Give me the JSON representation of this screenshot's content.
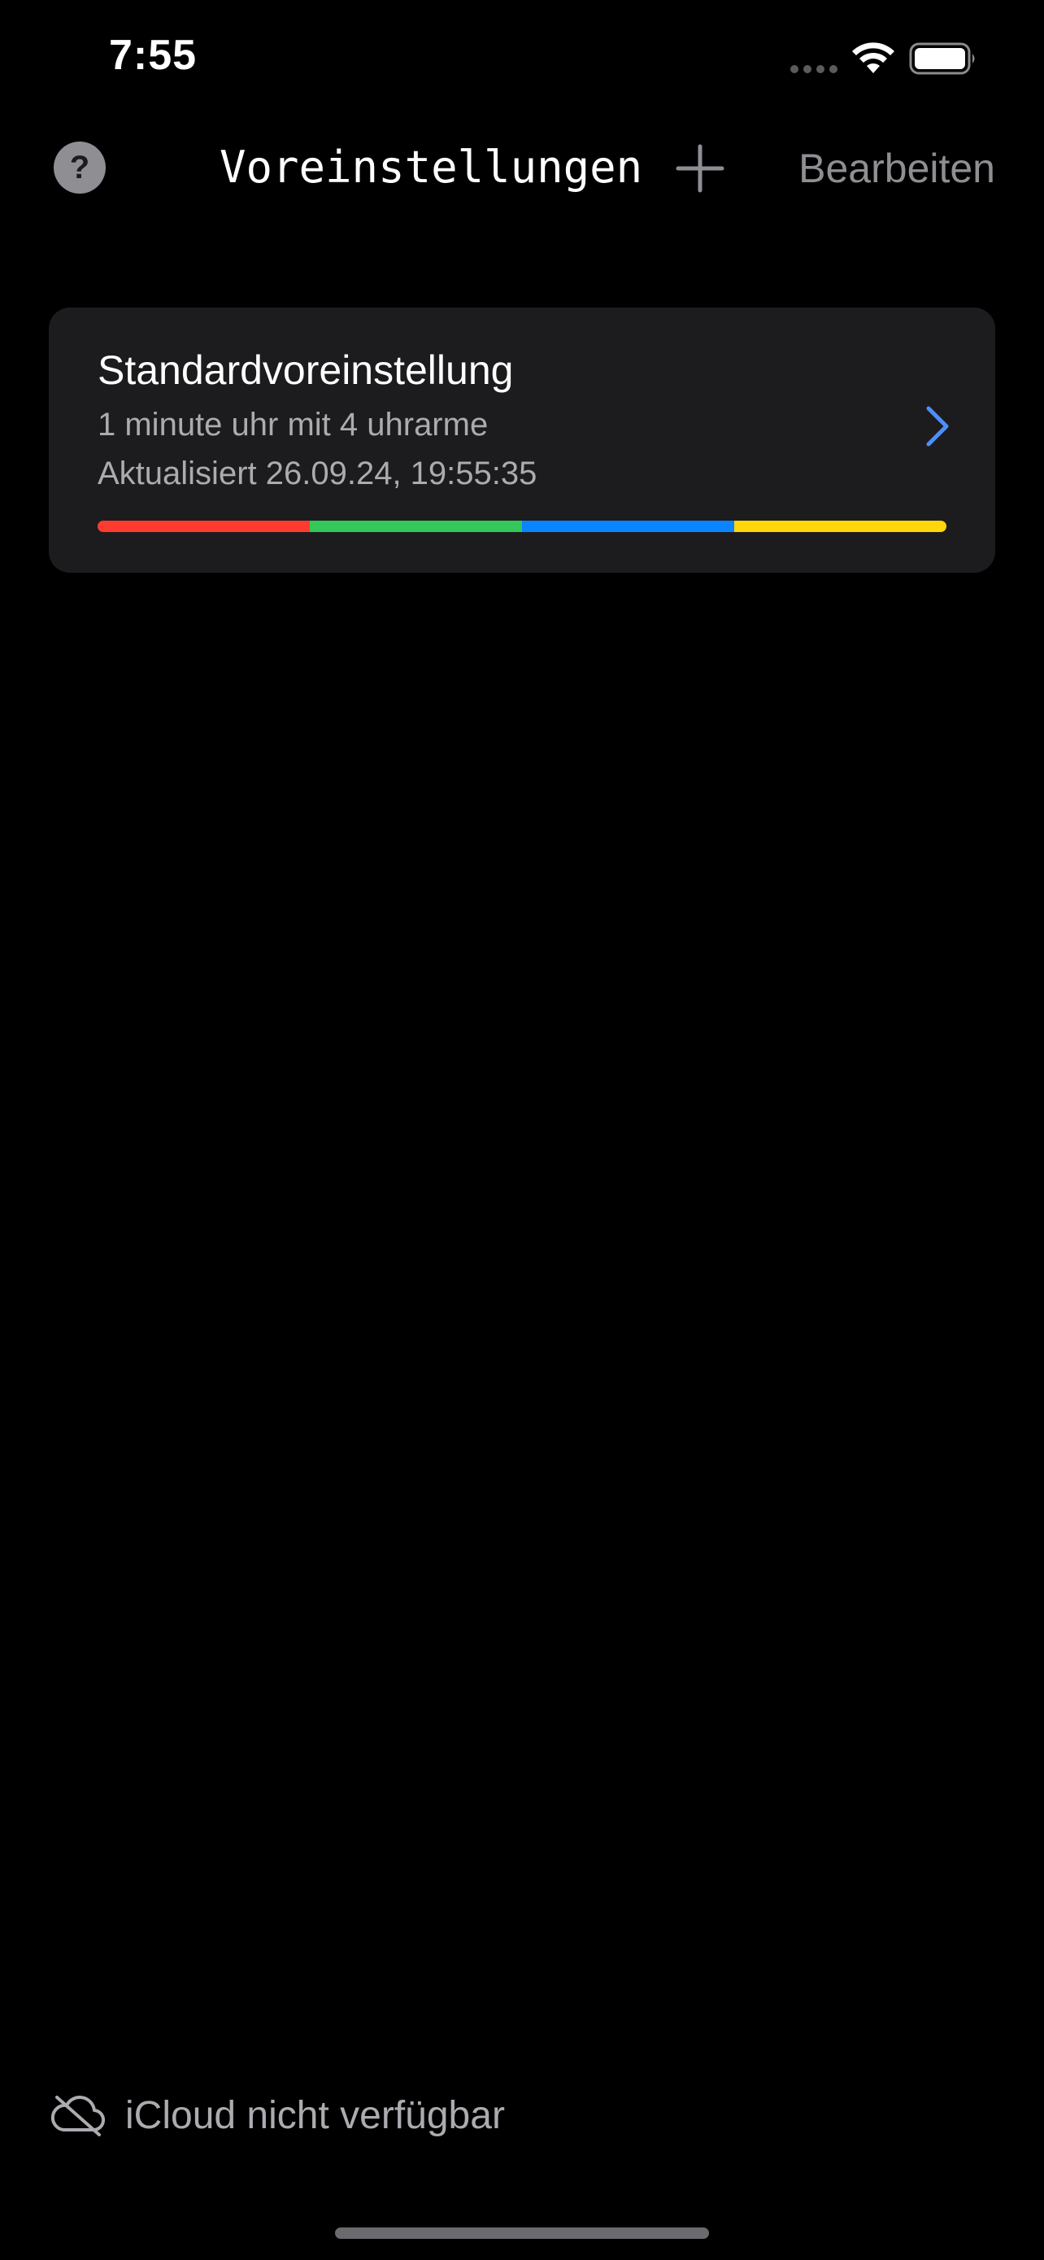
{
  "status_bar": {
    "time": "7:55"
  },
  "nav": {
    "help_label": "?",
    "title": "Voreinstellungen",
    "edit_label": "Bearbeiten"
  },
  "presets": [
    {
      "name": "Standardvoreinstellung",
      "description": "1 minute uhr mit 4 uhrarme",
      "updated": "Aktualisiert 26.09.24, 19:55:35",
      "colors": [
        "#ff3b30",
        "#34c759",
        "#0a84ff",
        "#ffd60a"
      ]
    }
  ],
  "footer": {
    "icloud_status": "iCloud nicht verfügbar"
  },
  "theme": {
    "background": "#000000",
    "card": "#1c1c1e",
    "accent": "#4f8ef7",
    "secondary_text": "#ababb0"
  }
}
